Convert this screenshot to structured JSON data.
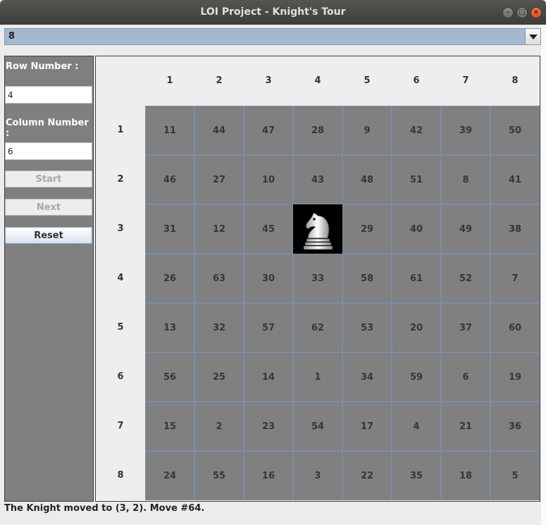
{
  "window": {
    "title": "LOI Project - Knight's Tour",
    "controls": [
      "minimize",
      "maximize",
      "close"
    ]
  },
  "size_select": {
    "selected": "8"
  },
  "left_panel": {
    "row_label": "Row Number :",
    "row_value": "4",
    "col_label": "Column Number :",
    "col_value": "6",
    "start_label": "Start",
    "next_label": "Next",
    "reset_label": "Reset"
  },
  "board": {
    "col_headers": [
      "1",
      "2",
      "3",
      "4",
      "5",
      "6",
      "7",
      "8"
    ],
    "row_headers": [
      "1",
      "2",
      "3",
      "4",
      "5",
      "6",
      "7",
      "8"
    ],
    "knight": {
      "row": 3,
      "col": 4
    },
    "cells": [
      [
        "11",
        "44",
        "47",
        "28",
        "9",
        "42",
        "39",
        "50"
      ],
      [
        "46",
        "27",
        "10",
        "43",
        "48",
        "51",
        "8",
        "41"
      ],
      [
        "31",
        "12",
        "45",
        "",
        "29",
        "40",
        "49",
        "38"
      ],
      [
        "26",
        "63",
        "30",
        "33",
        "58",
        "61",
        "52",
        "7"
      ],
      [
        "13",
        "32",
        "57",
        "62",
        "53",
        "20",
        "37",
        "60"
      ],
      [
        "56",
        "25",
        "14",
        "1",
        "34",
        "59",
        "6",
        "19"
      ],
      [
        "15",
        "2",
        "23",
        "54",
        "17",
        "4",
        "21",
        "36"
      ],
      [
        "24",
        "55",
        "16",
        "3",
        "22",
        "35",
        "18",
        "5"
      ]
    ]
  },
  "status": "The Knight moved to (3, 2). Move #64.",
  "colors": {
    "cell": "#808080",
    "grid_line": "#7a8ea8",
    "combo": "#a4b8ce"
  }
}
